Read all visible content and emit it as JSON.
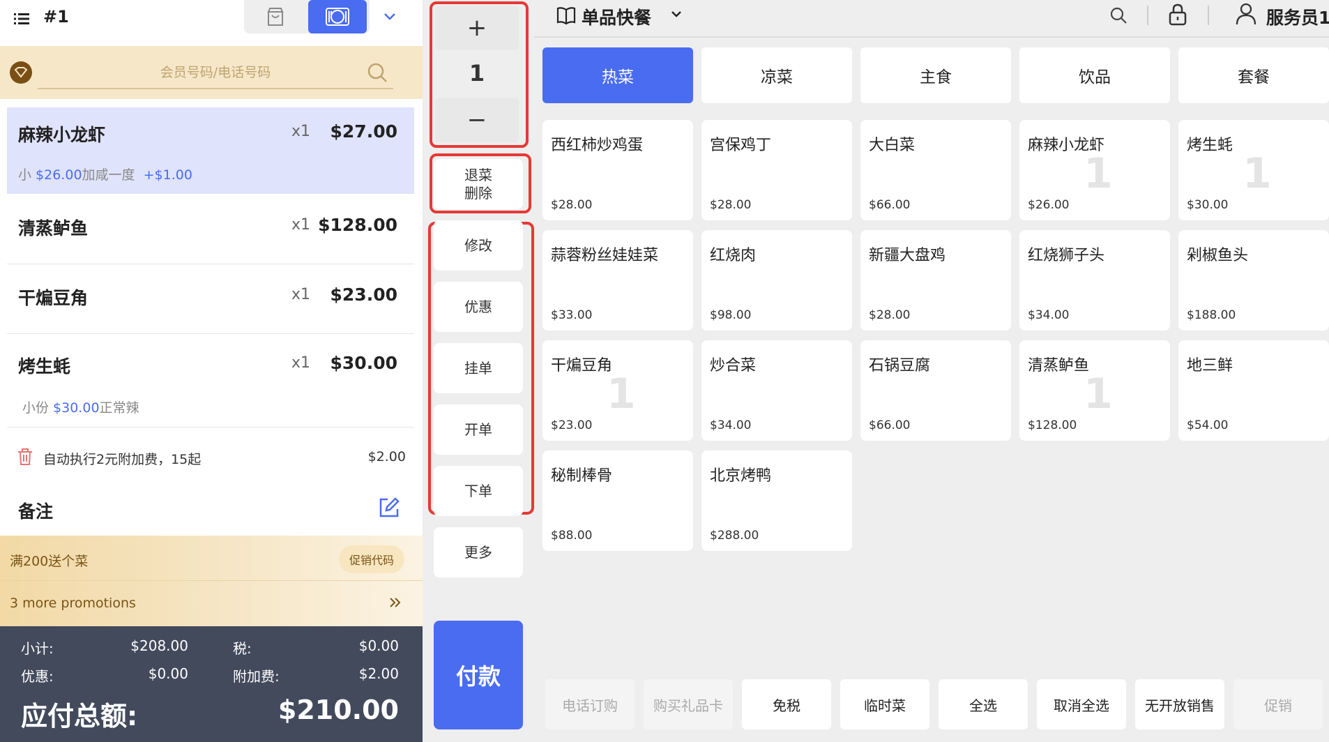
{
  "header": {
    "order_no": "#1"
  },
  "member": {
    "placeholder": "会员号码/电话号码"
  },
  "order_items": [
    {
      "name": "麻辣小龙虾",
      "qty": "x1",
      "price": "$27.00",
      "mod_prefix": "小 ",
      "mod_price": "$26.00",
      "mod_suffix": "加咸一度",
      "mod_extra": "+$1.00"
    },
    {
      "name": "清蒸鲈鱼",
      "qty": "x1",
      "price": "$128.00"
    },
    {
      "name": "干煸豆角",
      "qty": "x1",
      "price": "$23.00"
    },
    {
      "name": "烤生蚝",
      "qty": "x1",
      "price": "$30.00",
      "mod_prefix": "小份 ",
      "mod_price": "$30.00",
      "mod_suffix": "正常辣"
    }
  ],
  "fee": {
    "text": "自动执行2元附加费，15起",
    "amount": "$2.00"
  },
  "notes": {
    "label": "备注"
  },
  "promo": {
    "title": "满200送个菜",
    "code_button": "促销代码",
    "more": "3 more promotions"
  },
  "totals": {
    "subtotal_label": "小计:",
    "subtotal": "$208.00",
    "tax_label": "税:",
    "tax": "$0.00",
    "discount_label": "优惠:",
    "discount": "$0.00",
    "surcharge_label": "附加费:",
    "surcharge": "$2.00",
    "grand_label": "应付总额:",
    "grand": "$210.00"
  },
  "actions": {
    "qty_plus": "+",
    "qty_value": "1",
    "qty_minus": "−",
    "void_line1": "退菜",
    "void_line2": "删除",
    "modify": "修改",
    "discount": "优惠",
    "hold": "挂单",
    "open": "开单",
    "place": "下单",
    "more": "更多",
    "pay": "付款"
  },
  "topbar": {
    "menu_title": "单品快餐",
    "user": "服务员1"
  },
  "categories": [
    "热菜",
    "凉菜",
    "主食",
    "饮品",
    "套餐"
  ],
  "dishes": [
    {
      "name": "西红柿炒鸡蛋",
      "price": "$28.00",
      "count": ""
    },
    {
      "name": "宫保鸡丁",
      "price": "$28.00",
      "count": ""
    },
    {
      "name": "大白菜",
      "price": "$66.00",
      "count": ""
    },
    {
      "name": "麻辣小龙虾",
      "price": "$26.00",
      "count": "1"
    },
    {
      "name": "烤生蚝",
      "price": "$30.00",
      "count": "1"
    },
    {
      "name": "蒜蓉粉丝娃娃菜",
      "price": "$33.00",
      "count": ""
    },
    {
      "name": "红烧肉",
      "price": "$98.00",
      "count": ""
    },
    {
      "name": "新疆大盘鸡",
      "price": "$28.00",
      "count": ""
    },
    {
      "name": "红烧狮子头",
      "price": "$34.00",
      "count": ""
    },
    {
      "name": "剁椒鱼头",
      "price": "$188.00",
      "count": ""
    },
    {
      "name": "干煸豆角",
      "price": "$23.00",
      "count": "1"
    },
    {
      "name": "炒合菜",
      "price": "$34.00",
      "count": ""
    },
    {
      "name": "石锅豆腐",
      "price": "$66.00",
      "count": ""
    },
    {
      "name": "清蒸鲈鱼",
      "price": "$128.00",
      "count": "1"
    },
    {
      "name": "地三鲜",
      "price": "$54.00",
      "count": ""
    },
    {
      "name": "秘制棒骨",
      "price": "$88.00",
      "count": ""
    },
    {
      "name": "北京烤鸭",
      "price": "$288.00",
      "count": ""
    }
  ],
  "bottom_buttons": [
    {
      "label": "电话订购",
      "disabled": true
    },
    {
      "label": "购买礼品卡",
      "disabled": true
    },
    {
      "label": "免税",
      "disabled": false
    },
    {
      "label": "临时菜",
      "disabled": false
    },
    {
      "label": "全选",
      "disabled": false
    },
    {
      "label": "取消全选",
      "disabled": false
    },
    {
      "label": "无开放销售",
      "disabled": false
    },
    {
      "label": "促销",
      "disabled": true
    }
  ],
  "colors": {
    "accent": "#4a6cf0",
    "highlight_box": "#e53935",
    "totals_bg": "#424a5c",
    "member_bg": "#f6e7c9",
    "selected_row": "#dfe3fb"
  },
  "icons": [
    "menu-icon",
    "bag-icon",
    "dine-in-icon",
    "chevron-down-icon",
    "member-badge-icon",
    "search-icon",
    "trash-icon",
    "edit-icon",
    "chevron-right-icon",
    "book-icon",
    "lock-icon",
    "user-icon"
  ]
}
